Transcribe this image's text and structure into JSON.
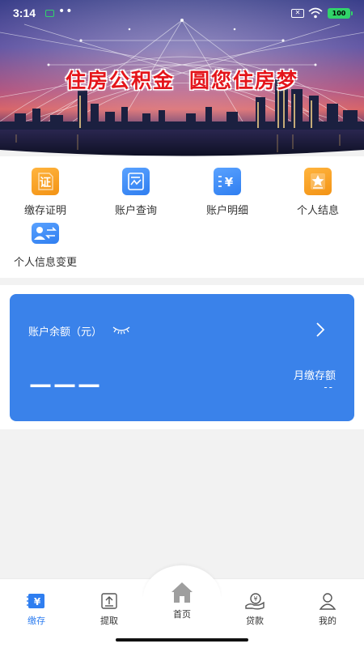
{
  "status_bar": {
    "time": "3:14",
    "dots": "••",
    "battery": "100"
  },
  "banner": {
    "title_part1": "住房公积金",
    "title_part2": "圆您住房梦"
  },
  "menu": [
    {
      "label": "缴存证明",
      "icon": "certificate-icon",
      "glyph": "证",
      "color": "#f39314"
    },
    {
      "label": "账户查询",
      "icon": "account-query-icon",
      "color": "#2f7ef0"
    },
    {
      "label": "账户明细",
      "icon": "account-detail-icon",
      "glyph": "¥",
      "color": "#2f7ef0"
    },
    {
      "label": "个人结息",
      "icon": "interest-star-icon",
      "color": "#f39314"
    },
    {
      "label": "个人信息变更",
      "icon": "info-change-icon",
      "color": "#2f7ef0"
    }
  ],
  "balance_card": {
    "label": "账户余额（元）",
    "amount": "———",
    "monthly_label": "月缴存额",
    "monthly_value": "--",
    "color": "#3a82ea"
  },
  "tabbar": [
    {
      "label": "缴存",
      "icon": "deposit-icon",
      "active": true
    },
    {
      "label": "提取",
      "icon": "withdraw-icon",
      "active": false
    },
    {
      "label": "首页",
      "icon": "home-icon",
      "active": false
    },
    {
      "label": "贷款",
      "icon": "loan-icon",
      "active": false
    },
    {
      "label": "我的",
      "icon": "profile-icon",
      "active": false
    }
  ],
  "colors": {
    "accent": "#2f7ef0",
    "orange": "#f39314",
    "title_red": "#e4151b"
  }
}
